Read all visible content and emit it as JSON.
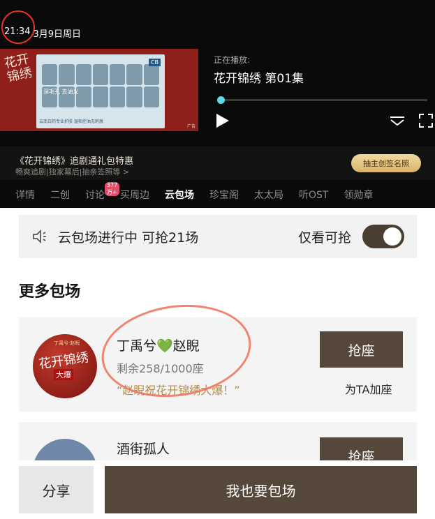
{
  "status": {
    "time": "21:34",
    "date": "3月9日周日"
  },
  "ad": {
    "text1": "深毛孔 去油光",
    "bottom": "云南白药专业护肤·温和控油无刺激",
    "corner": "广告",
    "tag": "CB"
  },
  "poster_logo": "花开锦绣",
  "player": {
    "now_label": "正在播放:",
    "title": "花开锦绣 第01集",
    "progress_percent": 1
  },
  "promo": {
    "title": "《花开锦绣》追剧通礼包特惠",
    "subtitle": "畅爽追剧|独家幕后|抽亲签照等 >",
    "button": "抽主创签名照"
  },
  "tabs": [
    {
      "label": "详情"
    },
    {
      "label": "二创"
    },
    {
      "label": "讨论",
      "badge": "377万+"
    },
    {
      "label": "买周边"
    },
    {
      "label": "云包场",
      "active": true
    },
    {
      "label": "珍宝阁"
    },
    {
      "label": "太太局"
    },
    {
      "label": "听OST"
    },
    {
      "label": "领勋章"
    }
  ],
  "banner": {
    "text": "云包场进行中 可抢21场",
    "toggle_label": "仅看可抢",
    "toggle_on": true
  },
  "more_title": "更多包场",
  "cards": [
    {
      "name_a": "丁禹兮",
      "heart": "💚",
      "name_b": "赵睨",
      "remain": "剩余258/1000座",
      "quote": "“赵睨祝花开锦绣大爆！”",
      "button": "抢座",
      "add": "为TA加座",
      "avatar_text": "花开锦绣",
      "avatar_small": "丁禹兮·赵睨",
      "avatar_tag": "大爆"
    },
    {
      "name": "酒街孤人",
      "button": "抢座"
    }
  ],
  "footer": {
    "share": "分享",
    "want": "我也要包场"
  },
  "colors": {
    "accent": "#55473a",
    "annotation": "#e0342a"
  }
}
